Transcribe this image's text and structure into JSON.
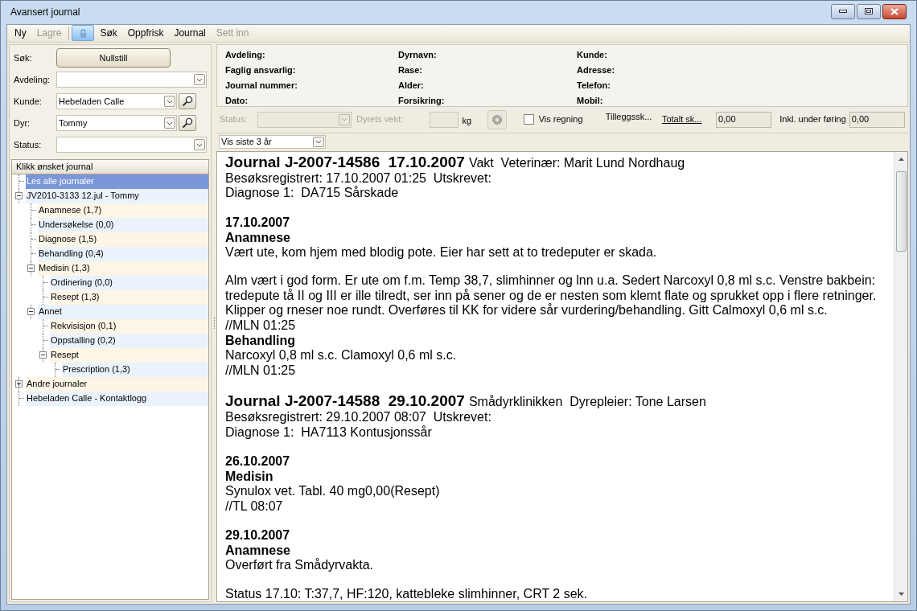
{
  "window": {
    "title": "Avansert journal"
  },
  "toolbar": [
    {
      "label": "Ny",
      "disabled": false
    },
    {
      "label": "Lagre",
      "disabled": true
    },
    {
      "kind": "lock"
    },
    {
      "label": "Søk",
      "disabled": false
    },
    {
      "label": "Oppfrisk",
      "disabled": false
    },
    {
      "label": "Journal",
      "disabled": false
    },
    {
      "label": "Sett inn",
      "disabled": true
    }
  ],
  "search": {
    "label": "Søk:",
    "reset_button": "Nullstill",
    "fields": [
      {
        "label": "Avdeling:",
        "lookup": false
      },
      {
        "label": "Kunde:",
        "value": "Hebeladen Calle",
        "lookup": true
      },
      {
        "label": "Dyr:",
        "value": "Tommy",
        "lookup": true
      },
      {
        "label": "Status:",
        "lookup": false
      }
    ]
  },
  "tree": {
    "header": "Klikk ønsket journal",
    "items": [
      {
        "label": "Les alle journaler",
        "selected": true
      },
      {
        "label": "JV2010-3133  12.jul - Tommy",
        "selected": false,
        "expanded": true,
        "children": [
          {
            "label": "Anamnese (1,7)",
            "selected": false
          },
          {
            "label": "Undersøkelse (0,0)",
            "selected": false
          },
          {
            "label": "Diagnose (1,5)",
            "selected": false
          },
          {
            "label": "Behandling (0,4)",
            "selected": false
          },
          {
            "label": "Medisin (1,3)",
            "selected": false,
            "expanded": true,
            "children": [
              {
                "label": "Ordinering (0,0)",
                "selected": false
              },
              {
                "label": "Resept (1,3)",
                "selected": false
              }
            ]
          },
          {
            "label": "Annet",
            "selected": false,
            "expanded": true,
            "children": [
              {
                "label": "Rekvisisjon (0,1)",
                "selected": false
              },
              {
                "label": "Oppstalling (0,2)",
                "selected": false
              },
              {
                "label": "Resept",
                "selected": false,
                "expanded": true,
                "children": [
                  {
                    "label": "Prescription (1,3)",
                    "selected": false
                  }
                ]
              }
            ]
          }
        ]
      },
      {
        "label": "Andre journaler",
        "selected": false,
        "expanded": false
      },
      {
        "label": "Hebeladen Calle - Kontaktlogg",
        "selected": false
      }
    ]
  },
  "info": {
    "columns": [
      [
        "Avdeling:",
        "Faglig ansvarlig:",
        "Journal nummer:",
        "Dato:"
      ],
      [
        "Dyrnavn:",
        "Rase:",
        "Alder:",
        "Forsikring:"
      ],
      [
        "Kunde:",
        "Adresse:",
        "Telefon:",
        "Mobil:"
      ]
    ]
  },
  "details": {
    "status_label": "Status:",
    "weight_label": "Dyrets vekt:",
    "weight_unit": "kg",
    "show_invoice": {
      "label": "Vis regning",
      "checked": false
    },
    "extra_label": "Tilleggssk...",
    "total_link": "Totalt sk...",
    "total_value": "0,00",
    "pending_label": "Inkl. under føring",
    "pending_value": "0,00"
  },
  "period": {
    "value": "Vis siste 3 år"
  },
  "document": [
    {
      "kind": "journal",
      "heading": "Journal J-2007-14586  17.10.2007",
      "detail": "Vakt  Veterinær: Marit Lund Nordhaug"
    },
    {
      "kind": "line",
      "text": "Besøksregistrert: 17.10.2007 01:25  Utskrevet:"
    },
    {
      "kind": "line",
      "text": "Diagnose 1:  DA715 Sårskade"
    },
    {
      "kind": "gap"
    },
    {
      "kind": "heading",
      "text": "17.10.2007"
    },
    {
      "kind": "heading",
      "text": "Anamnese"
    },
    {
      "kind": "line",
      "text": "Vært ute, kom hjem med blodig pote. Eier har sett at to tredeputer er skada."
    },
    {
      "kind": "gap"
    },
    {
      "kind": "line",
      "text": "Alm vært i god form. Er ute om f.m. Temp 38,7, slimhinner og lnn u.a. Sedert Narcoxyl 0,8 ml s.c. Venstre bakbein: tredepute tå II og III er ille tilredt, ser inn på sener og de er nesten som klemt flate og sprukket opp i flere retninger. Klipper og rneser noe rundt. Overføres til KK for videre sår vurdering/behandling. Gitt Calmoxyl 0,6 ml s.c."
    },
    {
      "kind": "line",
      "text": "//MLN 01:25"
    },
    {
      "kind": "heading",
      "text": "Behandling"
    },
    {
      "kind": "line",
      "text": "Narcoxyl 0,8 ml s.c. Clamoxyl 0,6 ml s.c."
    },
    {
      "kind": "line",
      "text": "//MLN 01:25"
    },
    {
      "kind": "gap"
    },
    {
      "kind": "journal",
      "heading": "Journal J-2007-14588  29.10.2007",
      "detail": "Smådyrklinikken  Dyrepleier: Tone Larsen"
    },
    {
      "kind": "line",
      "text": "Besøksregistrert: 29.10.2007 08:07  Utskrevet:"
    },
    {
      "kind": "line",
      "text": "Diagnose 1:  HA7113 Kontusjonssår"
    },
    {
      "kind": "gap"
    },
    {
      "kind": "heading",
      "text": "26.10.2007"
    },
    {
      "kind": "heading",
      "text": "Medisin"
    },
    {
      "kind": "line",
      "text": "Synulox vet. Tabl. 40 mg0,00(Resept)"
    },
    {
      "kind": "line",
      "text": "//TL 08:07"
    },
    {
      "kind": "gap"
    },
    {
      "kind": "heading",
      "text": "29.10.2007"
    },
    {
      "kind": "heading",
      "text": "Anamnese"
    },
    {
      "kind": "line",
      "text": "Overført fra Smådyrvakta."
    },
    {
      "kind": "gap"
    },
    {
      "kind": "line",
      "text": "Status 17.10: T:37,7, HF:120, kattebleke slimhinner, CRT 2 sek."
    }
  ]
}
